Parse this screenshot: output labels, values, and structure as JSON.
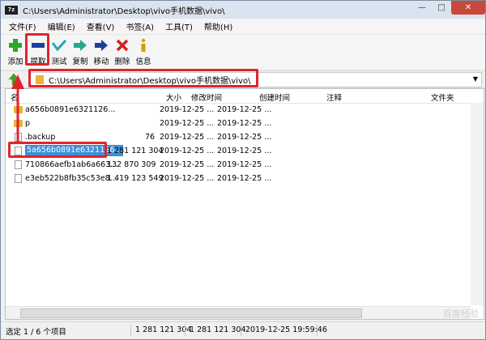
{
  "window": {
    "title": "C:\\Users\\Administrator\\Desktop\\vivo手机数据\\vivo\\",
    "app_icon": "7z"
  },
  "menu": [
    {
      "label": "文件(F)"
    },
    {
      "label": "编辑(E)"
    },
    {
      "label": "查看(V)"
    },
    {
      "label": "书签(A)"
    },
    {
      "label": "工具(T)"
    },
    {
      "label": "帮助(H)"
    }
  ],
  "toolbar": {
    "add": "添加",
    "extract": "提取",
    "test": "测试",
    "copy": "复制",
    "move": "移动",
    "delete": "删除",
    "info": "信息"
  },
  "address": {
    "path": "C:\\Users\\Administrator\\Desktop\\vivo手机数据\\vivo\\"
  },
  "columns": {
    "name": "名",
    "size": "大小",
    "modified": "修改时间",
    "created": "创建时间",
    "comment": "注释",
    "folder": "文件夹"
  },
  "rows": [
    {
      "name": "a656b0891e6321126...",
      "size": "",
      "modified": "2019-12-25 ...",
      "created": "2019-12-25 ...",
      "icon": "folder"
    },
    {
      "name": "p",
      "size": "",
      "modified": "2019-12-25 ...",
      "created": "2019-12-25 ...",
      "icon": "folder"
    },
    {
      "name": ".backup",
      "size": "76",
      "modified": "2019-12-25 ...",
      "created": "2019-12-25 ...",
      "icon": "file"
    },
    {
      "name": "5a656b0891e6321126...",
      "size": "1 281 121 304",
      "modified": "2019-12-25 ...",
      "created": "2019-12-25 ...",
      "icon": "file"
    },
    {
      "name": "710866aefb1ab6a663...",
      "size": "132 870 309",
      "modified": "2019-12-25 ...",
      "created": "2019-12-25 ...",
      "icon": "file"
    },
    {
      "name": "e3eb522b8fb35c53e8...",
      "size": "1 419 123 549",
      "modified": "2019-12-25 ...",
      "created": "2019-12-25 ...",
      "icon": "file"
    }
  ],
  "status": {
    "selection": "选定 1 / 6 个项目",
    "size1": "1 281 121 304",
    "size2": "1 281 121 304",
    "datetime": "2019-12-25 19:59:46"
  },
  "watermark": "百度经验",
  "colors": {
    "highlight": "#e0242c",
    "selection": "#3a8fd8",
    "folder": "#e8b43a"
  }
}
